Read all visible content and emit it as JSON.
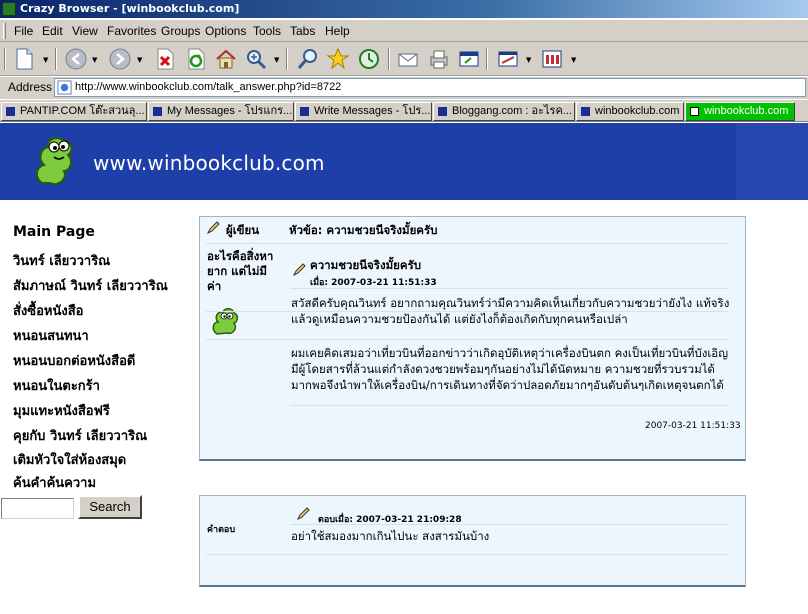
{
  "window": {
    "title": "Crazy Browser - [winbookclub.com]"
  },
  "menu": [
    "File",
    "Edit",
    "View",
    "Favorites",
    "Groups",
    "Options",
    "Tools",
    "Tabs",
    "Help"
  ],
  "address": {
    "label": "Address",
    "url": "http://www.winbookclub.com/talk_answer.php?id=8722"
  },
  "tabs": [
    {
      "label": "PANTIP.COM โต๊ะสวนลุ...",
      "active": false
    },
    {
      "label": "My Messages - โปรแกร...",
      "active": false
    },
    {
      "label": "Write Messages - โปร...",
      "active": false
    },
    {
      "label": "Bloggang.com : อะไรค...",
      "active": false
    },
    {
      "label": "winbookclub.com",
      "active": false
    },
    {
      "label": "winbookclub.com",
      "active": true
    }
  ],
  "banner": {
    "site_name": "www.winbookclub.com"
  },
  "sidebar": {
    "links": [
      "Main Page",
      "วินทร์ เลียววาริณ",
      "สัมภาษณ์ วินทร์ เลียววาริณ",
      "สั่งซื้อหนังสือ",
      "หนอนสนทนา",
      "หนอนบอกต่อหนังสือดี",
      "หนอนในตะกร้า",
      "มุมแทะหนังสือฟรี",
      "คุยกับ วินทร์ เลียววาริณ",
      "เติมหัวใจใส่ห้องสมุด",
      "ค้นคำค้นความ"
    ],
    "search_button": "Search"
  },
  "post1": {
    "author_header": "ผู้เขียน",
    "subject_header": "หัวข้อ: ความชวยนีจริงมั้ยครับ",
    "author_name": "อะไรคือสิ่งหายาก แต่ไม่มีค่า",
    "title": "ความชวยนีจริงมั้ยครับ",
    "date_line": "เมื่อ: 2007-03-21 11:51:33",
    "para1": "สวัสดีครับคุณวินทร์ อยากถามคุณวินทร์ว่ามีความคิดเห็นเกี่ยวกับความชวยว่ายังไง แท้จริงแล้วดูเหมือนความชวยป้องกันได้ แต่ยังไงก็ต้องเกิดกับทุกคนหรือเปล่า",
    "para2": "ผมเคยคิดเสมอว่าเที่ยวบินที่ออกข่าวว่าเกิดอุบัติเหตุว่าเครื่องบินตก คงเป็นเที่ยวบินที่บังเอิญมีผู้โดยสารที่ล้วนแต่กำลังดวงชวยพร้อมๆกันอย่างไม่ได้นัดหมาย ความชวยที่รวบรวมได้มากพอจึงนำพาให้เครื่องบิน/การเดินทางที่จัดว่าปลอดภัยมากๆอันดับต้นๆเกิดเหตุจนตกได้",
    "footer_time": "2007-03-21 11:51:33"
  },
  "post2": {
    "label": "คำตอบ",
    "date_line": "ตอบเมื่อ: 2007-03-21 21:09:28",
    "body": "อย่าใช้สมองมากเกินไปนะ สงสารมันบ้าง"
  }
}
